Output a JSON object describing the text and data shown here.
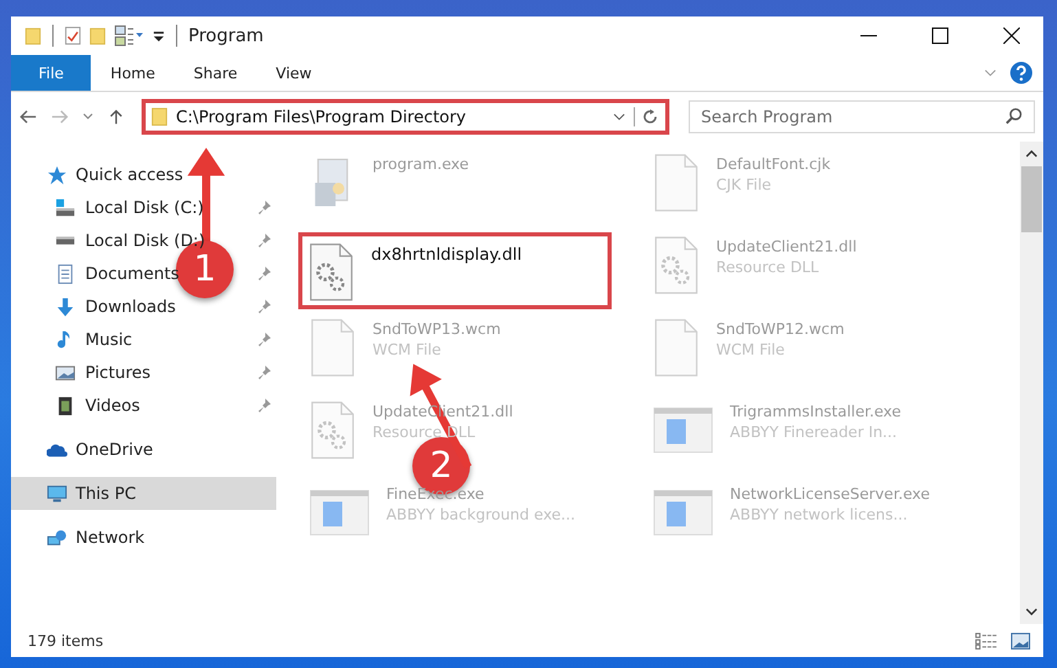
{
  "window": {
    "title": "Program"
  },
  "ribbon": {
    "tabs": [
      {
        "label": "File",
        "selected": true
      },
      {
        "label": "Home",
        "selected": false
      },
      {
        "label": "Share",
        "selected": false
      },
      {
        "label": "View",
        "selected": false
      }
    ]
  },
  "address": {
    "path": "C:\\Program Files\\Program Directory",
    "highlighted": true
  },
  "search": {
    "placeholder": "Search Program"
  },
  "sidebar": {
    "items": [
      {
        "label": "Quick access",
        "selected": false,
        "children": [
          {
            "label": "Local Disk (C:)",
            "pinned": true,
            "selected": false
          },
          {
            "label": "Local Disk (D:)",
            "pinned": true,
            "selected": false
          },
          {
            "label": "Documents",
            "pinned": true,
            "selected": false
          },
          {
            "label": "Downloads",
            "pinned": true,
            "selected": false
          },
          {
            "label": "Music",
            "pinned": true,
            "selected": false
          },
          {
            "label": "Pictures",
            "pinned": true,
            "selected": false
          },
          {
            "label": "Videos",
            "pinned": true,
            "selected": false
          }
        ]
      },
      {
        "label": "OneDrive",
        "selected": false
      },
      {
        "label": "This PC",
        "selected": true
      },
      {
        "label": "Network",
        "selected": false
      }
    ]
  },
  "files": [
    {
      "name": "program.exe",
      "kind": "exe",
      "highlighted": false
    },
    {
      "name": "DefaultFont.cjk",
      "type": "CJK File",
      "kind": "blank",
      "highlighted": false
    },
    {
      "name": "dx8hrtnldisplay.dll",
      "kind": "gear",
      "highlighted": true
    },
    {
      "name": "UpdateClient21.dll",
      "type": "Resource DLL",
      "kind": "gear",
      "highlighted": false
    },
    {
      "name": "SndToWP13.wcm",
      "type": "WCM File",
      "kind": "blank",
      "highlighted": false
    },
    {
      "name": "SndToWP12.wcm",
      "type": "WCM File",
      "kind": "blank",
      "highlighted": false
    },
    {
      "name": "UpdateClient21.dll",
      "type": "Resource DLL",
      "kind": "gear",
      "highlighted": false
    },
    {
      "name": "TrigrammsInstaller.exe",
      "type": "ABBYY Finereader In...",
      "kind": "app",
      "highlighted": false
    },
    {
      "name": "FineExec.exe",
      "type": "ABBYY background exe...",
      "kind": "app",
      "highlighted": false
    },
    {
      "name": "NetworkLicenseServer.exe",
      "type": "ABBYY network licens...",
      "kind": "app",
      "highlighted": false
    }
  ],
  "annotations": [
    {
      "label": "1"
    },
    {
      "label": "2"
    }
  ],
  "status_bar": {
    "count": "179 items"
  }
}
